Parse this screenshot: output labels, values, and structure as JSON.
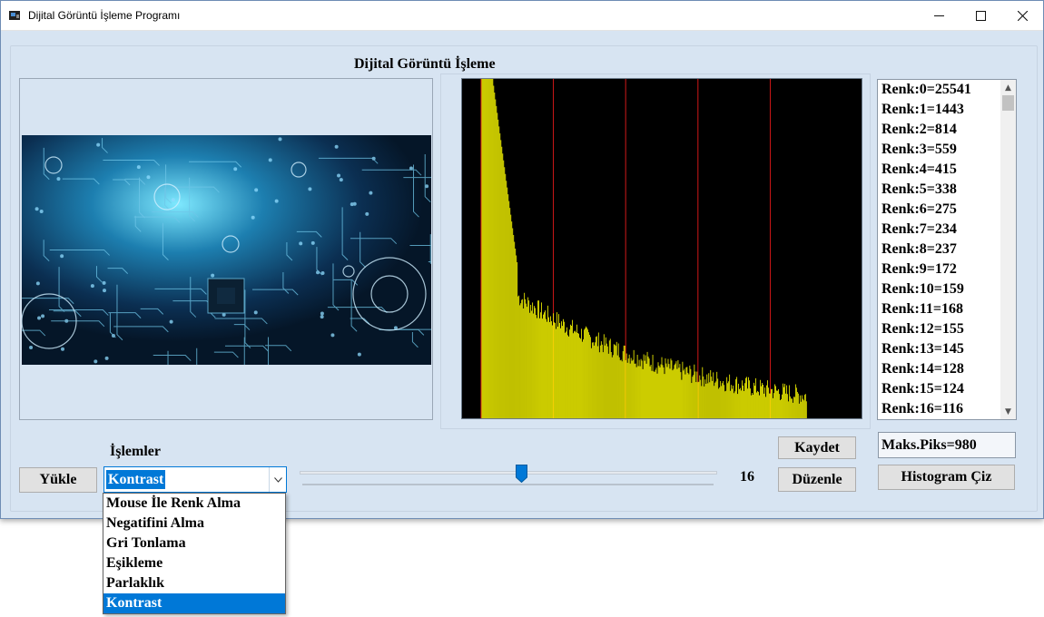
{
  "window": {
    "title": "Dijital Görüntü İşleme Programı",
    "heading": "Dijital Görüntü İşleme"
  },
  "image_panel": {
    "image": "circuit-board-blue-image"
  },
  "histogram": {
    "background": "#000000",
    "bar_color": "#ffff00",
    "gridline_color": "#d01818",
    "gridline_count": 5
  },
  "color_list": {
    "items": [
      "Renk:0=25541",
      "Renk:1=1443",
      "Renk:2=814",
      "Renk:3=559",
      "Renk:4=415",
      "Renk:5=338",
      "Renk:6=275",
      "Renk:7=234",
      "Renk:8=237",
      "Renk:9=172",
      "Renk:10=159",
      "Renk:11=168",
      "Renk:12=155",
      "Renk:13=145",
      "Renk:14=128",
      "Renk:15=124",
      "Renk:16=116"
    ]
  },
  "controls": {
    "load_button": "Yükle",
    "operations_label": "İşlemler",
    "combo_value": "Kontrast",
    "dropdown_options": [
      "Mouse İle Renk Alma",
      "Negatifini Alma",
      "Gri Tonlama",
      "Eşikleme",
      "Parlaklık",
      "Kontrast"
    ],
    "selected_option": "Kontrast",
    "slider_value": "16",
    "slider_fraction": 0.53,
    "save_button": "Kaydet",
    "edit_button": "Düzenle",
    "max_pixel": "Maks.Piks=980",
    "histogram_button": "Histogram Çiz"
  },
  "colors": {
    "window_bg": "#d7e4f2",
    "accent": "#0078d7"
  }
}
